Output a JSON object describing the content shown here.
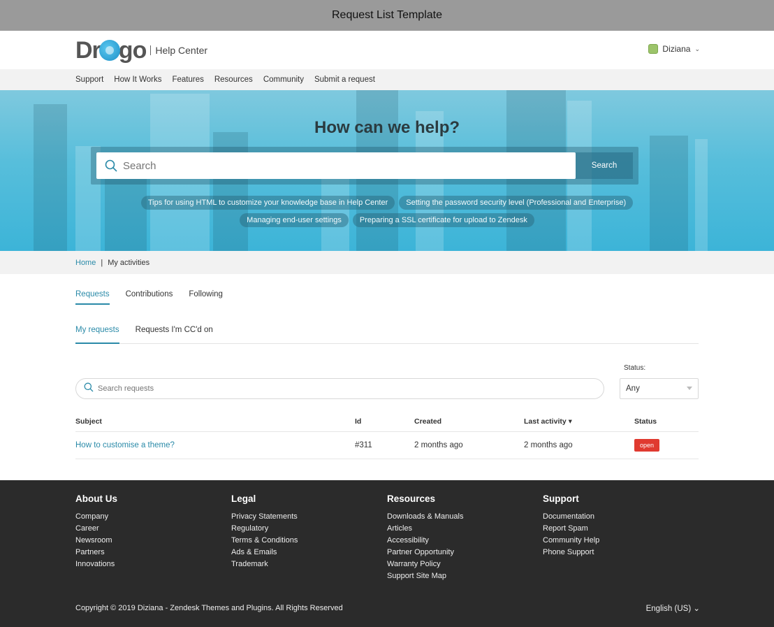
{
  "window": {
    "title": "Request List Template"
  },
  "header": {
    "logo_letters_left": "Dr",
    "logo_letters_right": "go",
    "logo_subtitle": "Help Center",
    "user_name": "Diziana"
  },
  "nav": {
    "items": [
      "Support",
      "How It Works",
      "Features",
      "Resources",
      "Community",
      "Submit a request"
    ]
  },
  "hero": {
    "title": "How can we help?",
    "search_placeholder": "Search",
    "search_button": "Search",
    "suggestions_row1": [
      "Tips for using HTML to customize your knowledge base in Help Center",
      "Setting the password security level (Professional and Enterprise)"
    ],
    "suggestions_row2": [
      "Managing end-user settings",
      "Preparing a SSL certificate for upload to Zendesk"
    ]
  },
  "breadcrumb": {
    "home": "Home",
    "separator": "|",
    "current": "My activities"
  },
  "activity_tabs": {
    "items": [
      "Requests",
      "Contributions",
      "Following"
    ],
    "active": "Requests"
  },
  "request_tabs": {
    "items": [
      "My requests",
      "Requests I'm CC'd on"
    ],
    "active": "My requests"
  },
  "filters": {
    "search_placeholder": "Search requests",
    "status_label": "Status:",
    "status_value": "Any"
  },
  "table": {
    "headers": {
      "subject": "Subject",
      "id": "Id",
      "created": "Created",
      "last_activity": "Last activity ▾",
      "status": "Status"
    },
    "rows": [
      {
        "subject": "How to customise a theme?",
        "id": "#311",
        "created": "2 months ago",
        "last_activity": "2 months ago",
        "status": "open"
      }
    ]
  },
  "footer": {
    "columns": [
      {
        "title": "About Us",
        "links": [
          "Company",
          "Career",
          "Newsroom",
          "Partners",
          "Innovations"
        ]
      },
      {
        "title": "Legal",
        "links": [
          "Privacy Statements",
          "Regulatory",
          "Terms & Conditions",
          "Ads & Emails",
          "Trademark"
        ]
      },
      {
        "title": "Resources",
        "links": [
          "Downloads & Manuals",
          "Articles",
          "Accessibility",
          "Partner Opportunity",
          "Warranty Policy",
          "Support Site Map"
        ]
      },
      {
        "title": "Support",
        "links": [
          "Documentation",
          "Report Spam",
          "Community Help",
          "Phone Support"
        ]
      }
    ],
    "copyright": "Copyright © 2019 Diziana - Zendesk Themes and Plugins. All Rights Reserved",
    "language": "English (US) ⌄"
  },
  "colors": {
    "accent": "#2a8aa8",
    "status_open": "#e03a30",
    "footer_bg": "#2b2b2b",
    "hero": "#57bedb"
  }
}
